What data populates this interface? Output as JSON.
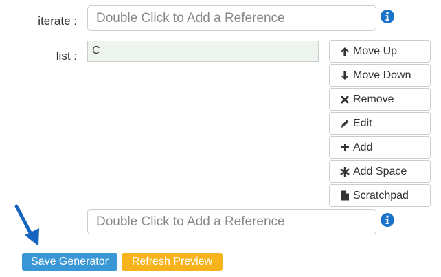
{
  "iterate": {
    "label": "iterate :",
    "placeholder": "Double Click to Add a Reference",
    "info_icon": "info-circle-icon"
  },
  "list": {
    "label": "list :",
    "items": [
      "C"
    ]
  },
  "list_buttons": [
    {
      "label": "Move Up",
      "icon": "arrow-up-icon"
    },
    {
      "label": "Move Down",
      "icon": "arrow-down-icon"
    },
    {
      "label": "Remove",
      "icon": "times-icon"
    },
    {
      "label": "Edit",
      "icon": "pencil-icon"
    },
    {
      "label": "Add",
      "icon": "plus-icon"
    },
    {
      "label": "Add Space",
      "icon": "asterisk-icon"
    },
    {
      "label": "Scratchpad",
      "icon": "file-icon"
    }
  ],
  "second_reference": {
    "placeholder": "Double Click to Add a Reference",
    "info_icon": "info-circle-icon"
  },
  "actions": {
    "save_label": "Save Generator",
    "refresh_label": "Refresh Preview"
  },
  "colors": {
    "primary": "#3a97d6",
    "warning": "#f6b31c",
    "info_icon": "#1a73c8",
    "list_background": "#eef5ee",
    "arrow": "#1565c0"
  }
}
